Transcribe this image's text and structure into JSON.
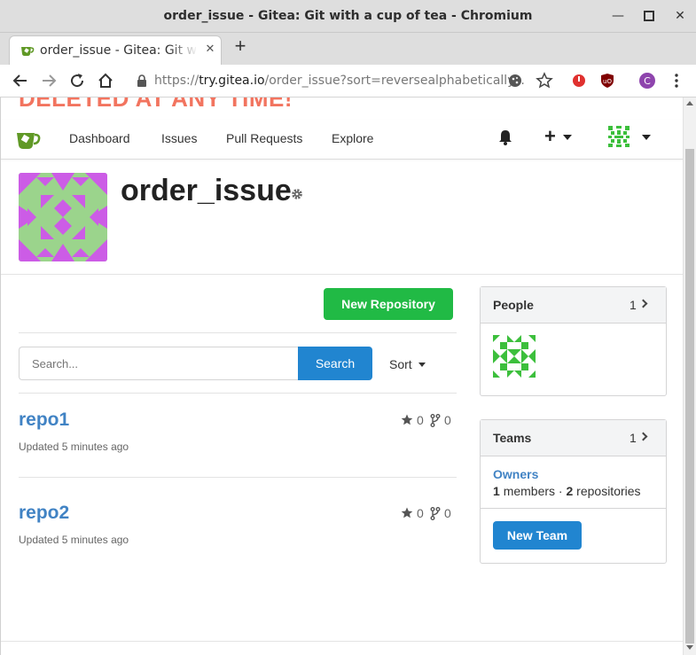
{
  "window": {
    "title": "order_issue - Gitea: Git with a cup of tea - Chromium"
  },
  "tab": {
    "title": "order_issue - Gitea: Git with a cup of tea"
  },
  "address_bar": {
    "scheme": "https://",
    "host": "try.gitea.io",
    "path": "/order_issue?sort=reversealphabetically..."
  },
  "profile": {
    "initial": "C"
  },
  "banner": {
    "text": "DELETED AT ANY TIME!"
  },
  "navbar": {
    "links": [
      "Dashboard",
      "Issues",
      "Pull Requests",
      "Explore"
    ],
    "plus": "+"
  },
  "org": {
    "name": "order_issue"
  },
  "actions": {
    "new_repository": "New Repository"
  },
  "search": {
    "placeholder": "Search...",
    "button": "Search",
    "sort_label": "Sort"
  },
  "repos": [
    {
      "name": "repo1",
      "updated": "Updated 5 minutes ago",
      "stars": "0",
      "forks": "0"
    },
    {
      "name": "repo2",
      "updated": "Updated 5 minutes ago",
      "stars": "0",
      "forks": "0"
    }
  ],
  "people": {
    "title": "People",
    "count": "1"
  },
  "teams": {
    "title": "Teams",
    "count": "1",
    "items": [
      {
        "name": "Owners",
        "members": "1",
        "members_label": "members ·",
        "repositories": "2",
        "repositories_label": "repositories"
      }
    ],
    "new_team": "New Team"
  },
  "colors": {
    "banner": "#f2745f",
    "green_button": "#21ba45",
    "blue_button": "#2185d0",
    "link": "#4183c4",
    "org_avatar_bg": "#9bd48c",
    "org_avatar_accent": "#cc5ce6"
  }
}
